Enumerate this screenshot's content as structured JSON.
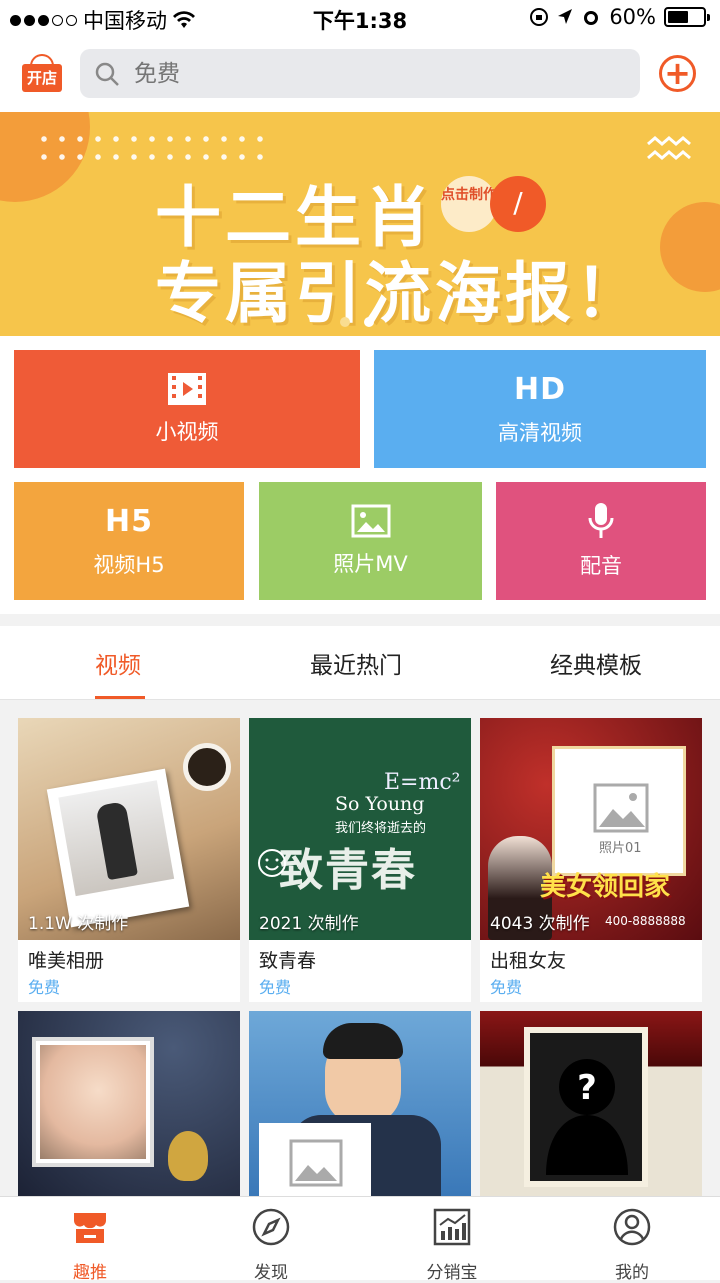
{
  "status": {
    "carrier": "中国移动",
    "time": "下午1:38",
    "battery": "60%",
    "battery_level": 0.6
  },
  "header": {
    "shop_label": "开店",
    "search_placeholder": "免费"
  },
  "banner": {
    "line1": "十二生肖",
    "line2": "专属引流海报！",
    "badge": "点击制作",
    "page_count": 2,
    "active_page": 1
  },
  "tiles": [
    {
      "label": "小视频",
      "icon": "film-icon"
    },
    {
      "label": "高清视频",
      "big": "HD"
    },
    {
      "label": "视频H5",
      "big": "H5"
    },
    {
      "label": "照片MV",
      "icon": "photo-icon"
    },
    {
      "label": "配音",
      "icon": "microphone-icon"
    }
  ],
  "tabs": [
    {
      "label": "视频",
      "active": true
    },
    {
      "label": "最近热门",
      "active": false
    },
    {
      "label": "经典模板",
      "active": false
    }
  ],
  "cards": [
    {
      "count": "1.1W 次制作",
      "title": "唯美相册",
      "price": "免费"
    },
    {
      "count": "2021 次制作",
      "title": "致青春",
      "price": "免费",
      "art1": "So Young",
      "art2": "我们终将逝去的",
      "art3": "致青春",
      "art4": "E=mc²"
    },
    {
      "count": "4043 次制作",
      "title": "出租女友",
      "price": "免费",
      "art1": "照片01",
      "art2": "美女领回家",
      "art3": "400-8888888"
    }
  ],
  "tabbar": [
    {
      "label": "趣推",
      "icon": "store-icon",
      "active": true
    },
    {
      "label": "发现",
      "icon": "compass-icon",
      "active": false
    },
    {
      "label": "分销宝",
      "icon": "chart-icon",
      "active": false
    },
    {
      "label": "我的",
      "icon": "user-icon",
      "active": false
    }
  ],
  "colors": {
    "accent": "#f05a28",
    "blue": "#5aaef0"
  }
}
